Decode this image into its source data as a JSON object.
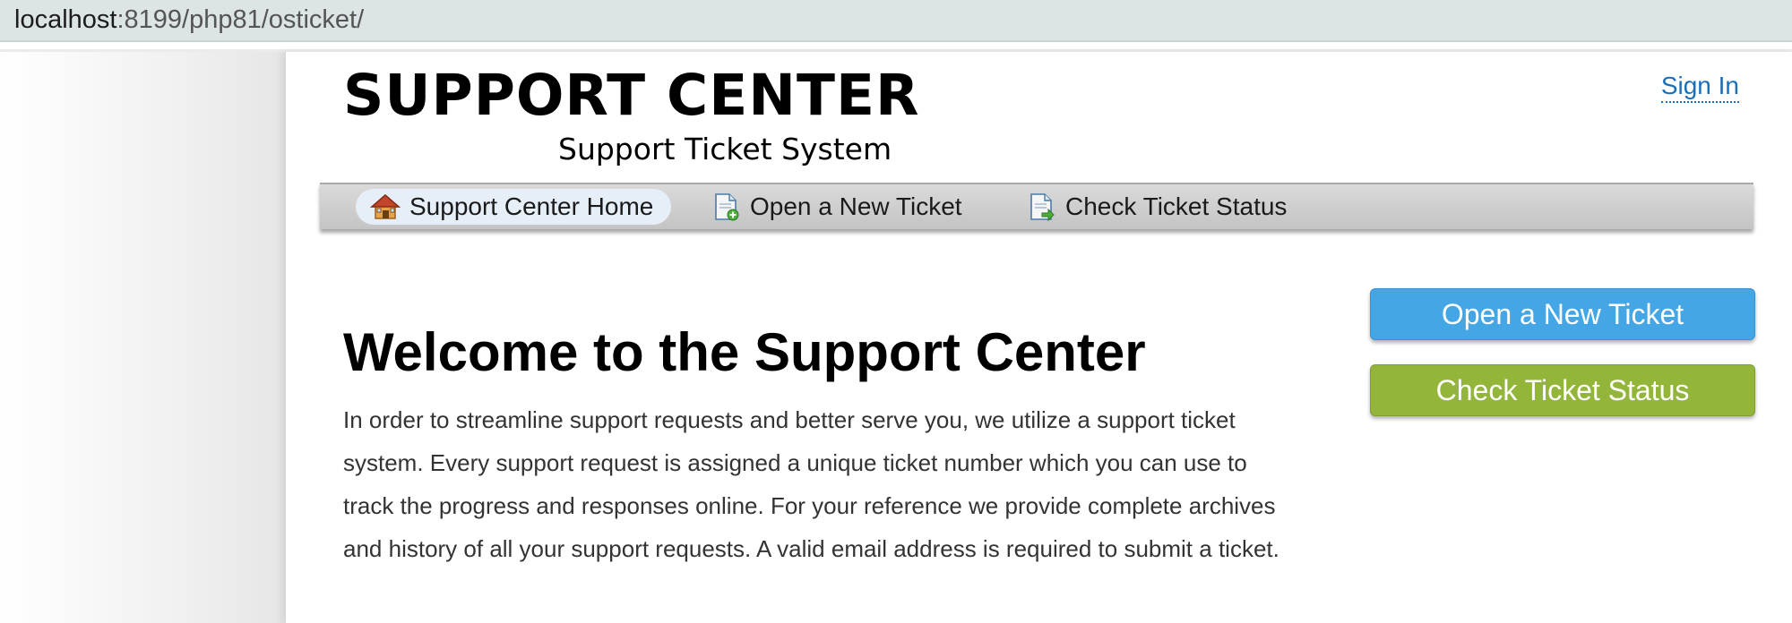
{
  "browser": {
    "url_host": "localhost",
    "url_path": ":8199/php81/osticket/"
  },
  "header": {
    "title": "SUPPORT CENTER",
    "subtitle": "Support Ticket System",
    "signin_label": "Sign In"
  },
  "nav": {
    "items": [
      {
        "label": "Support Center Home",
        "icon": "home-icon",
        "active": true
      },
      {
        "label": "Open a New Ticket",
        "icon": "new-ticket-icon",
        "active": false
      },
      {
        "label": "Check Ticket Status",
        "icon": "ticket-status-icon",
        "active": false
      }
    ]
  },
  "main": {
    "heading": "Welcome to the Support Center",
    "intro": "In order to streamline support requests and better serve you, we utilize a support ticket system. Every support request is assigned a unique ticket number which you can use to track the progress and responses online. For your reference we provide complete archives and history of all your support requests. A valid email address is required to submit a ticket."
  },
  "sidebar": {
    "open_ticket_label": "Open a New Ticket",
    "check_status_label": "Check Ticket Status"
  },
  "colors": {
    "link": "#1a6fb7",
    "open_button": "#45a6e6",
    "status_button": "#92b53a"
  }
}
